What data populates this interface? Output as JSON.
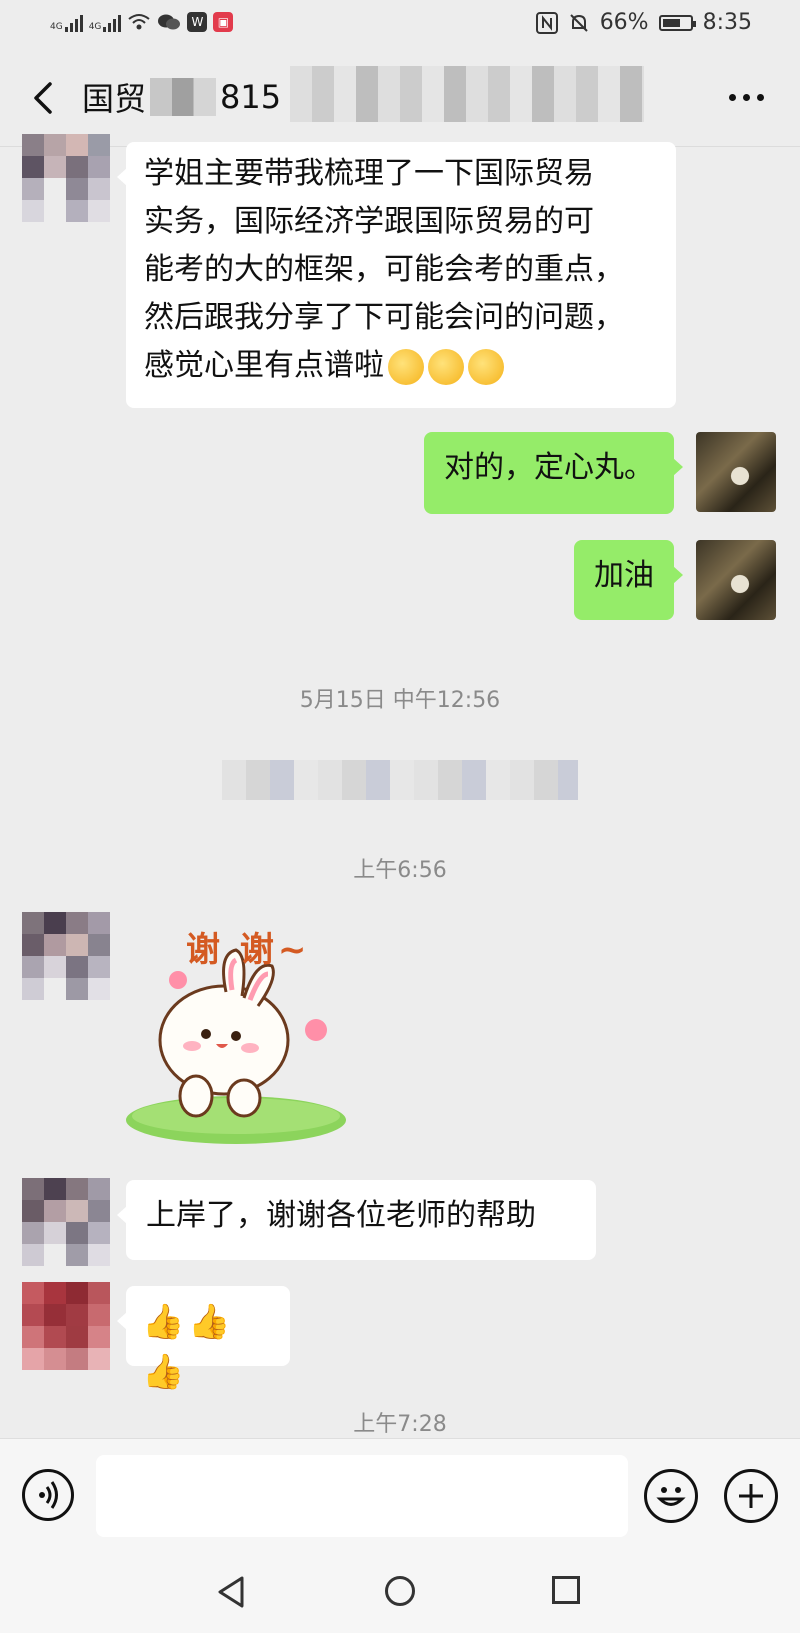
{
  "status_bar": {
    "signal_1": "4G",
    "signal_2": "4G",
    "battery": "66%",
    "battery_level": 0.66,
    "time": "8:35"
  },
  "header": {
    "title_prefix": "国贸",
    "title_suffix": "815"
  },
  "messages": [
    {
      "side": "left",
      "text_lines": [
        "学姐主要带我梳理了一下国际贸易",
        "实务，国际经济学跟国际贸易的可",
        "能考的大的框架，可能会考的重点，",
        "然后跟我分享了下可能会问的问题，",
        "感觉心里有点谱啦"
      ]
    },
    {
      "side": "right",
      "text": "对的，定心丸。"
    },
    {
      "side": "right",
      "text": "加油"
    },
    {
      "side": "left",
      "text": "上岸了，谢谢各位老师的帮助"
    }
  ],
  "timestamps": {
    "t1": "5月15日 中午12:56",
    "t2": "上午6:56",
    "t3": "上午7:28"
  },
  "sticker": {
    "caption": "谢 谢~"
  },
  "colors": {
    "background": "#ededed",
    "bubble_self": "#95ec69",
    "bubble_other": "#ffffff"
  },
  "icons": [
    "back-icon",
    "more-icon",
    "voice-icon",
    "emoji-icon",
    "plus-icon",
    "nav-back-icon",
    "nav-home-icon",
    "nav-recent-icon"
  ]
}
